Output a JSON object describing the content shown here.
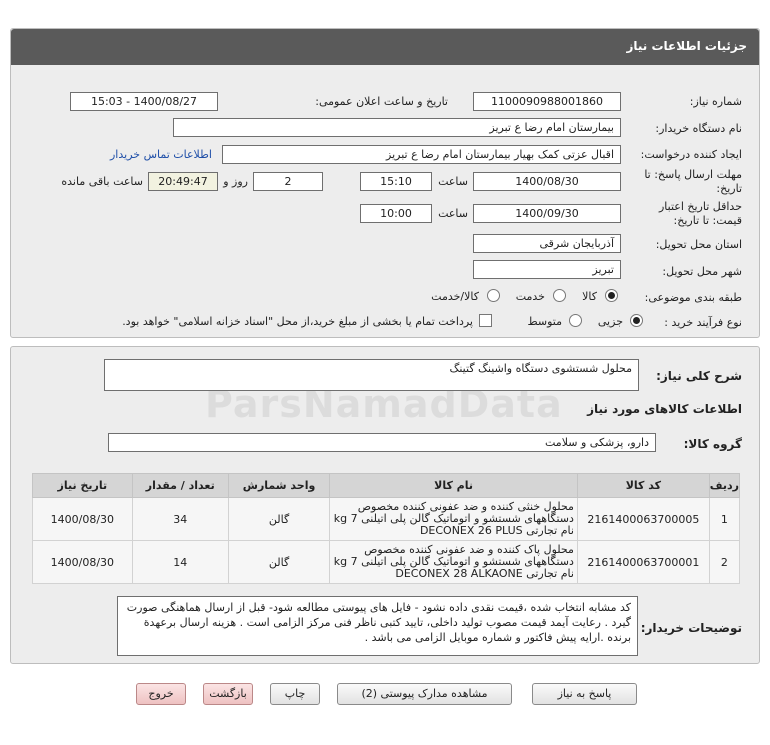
{
  "header": {
    "title": "جزئیات اطلاعات نیاز"
  },
  "form": {
    "need_number": {
      "label": "شماره نیاز:",
      "value": "1100090988001860"
    },
    "announce_datetime": {
      "label": "تاریخ و ساعت اعلان عمومی:",
      "value": "1400/08/27 - 15:03"
    },
    "buyer_org": {
      "label": "نام دستگاه خریدار:",
      "value": "بیمارستان امام رضا  ع  تبریز"
    },
    "requester": {
      "label": "ایجاد کننده درخواست:",
      "value": "اقبال عزتی کمک بهیار بیمارستان امام رضا  ع  تبریز",
      "contact_link": "اطلاعات تماس خریدار"
    },
    "reply_deadline": {
      "label_line1": "مهلت ارسال پاسخ: تا",
      "label_line2": "تاریخ:",
      "date": "1400/08/30",
      "time_label": "ساعت",
      "time": "15:10",
      "days": "2",
      "days_label": "روز و",
      "remaining": "20:49:47",
      "remaining_label": "ساعت باقی مانده"
    },
    "validity_deadline": {
      "label_line1": "حداقل تاریخ اعتبار",
      "label_line2": "قیمت: تا تاریخ:",
      "date": "1400/09/30",
      "time_label": "ساعت",
      "time": "10:00"
    },
    "province": {
      "label": "استان محل تحویل:",
      "value": "آذربایجان شرقی"
    },
    "city": {
      "label": "شهر محل تحویل:",
      "value": "تبریز"
    },
    "category": {
      "label": "طبقه بندی موضوعی:",
      "options": [
        "کالا",
        "خدمت",
        "کالا/خدمت"
      ],
      "selected": "کالا"
    },
    "purchase_process": {
      "label": "نوع فرآیند خرید :",
      "options": [
        "جزیی",
        "متوسط"
      ],
      "selected": "جزیی",
      "checkbox_text": "پرداخت تمام یا بخشی از مبلغ خرید،از محل \"اسناد خزانه اسلامی\" خواهد بود."
    }
  },
  "summary": {
    "label": "شرح کلی نیاز:",
    "value": "محلول شستشوی دستگاه واشینگ گتینگ"
  },
  "goods_section": {
    "title": "اطلاعات کالاهای مورد نیاز",
    "group_label": "گروه کالا:",
    "group_value": "دارو، پزشکی و سلامت"
  },
  "table": {
    "headers": [
      "ردیف",
      "کد کالا",
      "نام کالا",
      "واحد شمارش",
      "تعداد / مقدار",
      "تاریخ نیاز"
    ],
    "rows": [
      {
        "row": "1",
        "code": "2161400063700005",
        "name": "محلول خنثی کننده و ضد عفونی کننده مخصوص دستگاههای شستشو و اتوماتیک گالن پلی اتیلنی 7 kg نام تجارتی DECONEX 26 PLUS",
        "unit": "گالن",
        "qty": "34",
        "date": "1400/08/30"
      },
      {
        "row": "2",
        "code": "2161400063700001",
        "name": "محلول پاک کننده و ضد عفونی کننده مخصوص دستگاههای شستشو و اتوماتیک گالن پلی اتیلنی 7 kg نام تجارتی DECONEX 28 ALKAONE",
        "unit": "گالن",
        "qty": "14",
        "date": "1400/08/30"
      }
    ]
  },
  "buyer_notes": {
    "label": "توضیحات خریدار:",
    "text": "کد مشابه انتخاب شده ،قیمت نقدی داده نشود - فایل های پیوستی مطالعه شود- قبل از ارسال هماهنگی صورت گیرد . رعایت آیمد قیمت مصوب تولید داخلی، تایید کتبی ناظر فنی مرکز الزامی است . هزینه ارسال برعهدة برنده .ارایه پیش فاکتور و شماره موبایل الزامی می باشد ."
  },
  "buttons": {
    "reply": "پاسخ به نیاز",
    "attachments": "مشاهده مدارک پیوستی (2)",
    "print": "چاپ",
    "back": "بازگشت",
    "exit": "خروج"
  }
}
